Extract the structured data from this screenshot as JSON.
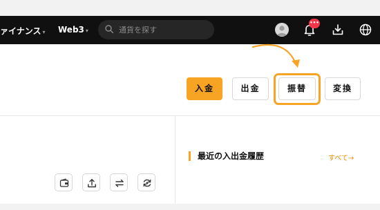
{
  "nav": {
    "items": [
      {
        "label": "ァイナンス",
        "caret": "▾"
      },
      {
        "label": "Web3",
        "caret": "▾"
      }
    ],
    "search_placeholder": "通貨を探す",
    "notification_badge": "•••"
  },
  "actions": {
    "deposit": "入金",
    "withdraw": "出金",
    "transfer": "振替",
    "convert": "変換"
  },
  "history": {
    "title": "最近の入出金履歴",
    "see_all": "すべて→"
  },
  "colors": {
    "accent": "#f7a425",
    "topbar": "#101010",
    "badge": "#f3364a"
  },
  "icons": [
    "search-icon",
    "avatar",
    "bell-icon",
    "download-icon",
    "globe-icon",
    "wallet-icon",
    "upload-icon",
    "swap-icon",
    "refresh-icon",
    "pointer-arrow"
  ]
}
